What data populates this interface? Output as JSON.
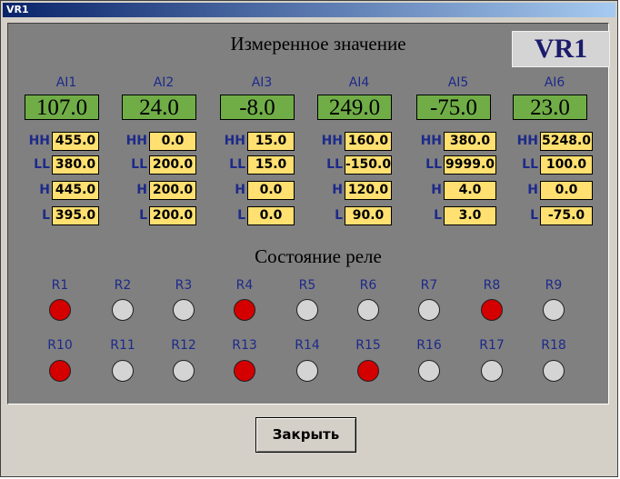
{
  "window": {
    "title": "VR1"
  },
  "header": {
    "title": "Измеренное значение",
    "device": "VR1"
  },
  "channels": [
    {
      "label": "AI1",
      "value": "107.0",
      "HH": "455.0",
      "LL": "380.0",
      "H": "445.0",
      "L": "395.0"
    },
    {
      "label": "AI2",
      "value": "24.0",
      "HH": "0.0",
      "LL": "200.0",
      "H": "200.0",
      "L": "200.0"
    },
    {
      "label": "AI3",
      "value": "-8.0",
      "HH": "15.0",
      "LL": "15.0",
      "H": "0.0",
      "L": "0.0"
    },
    {
      "label": "AI4",
      "value": "249.0",
      "HH": "160.0",
      "LL": "-150.0",
      "H": "120.0",
      "L": "90.0"
    },
    {
      "label": "AI5",
      "value": "-75.0",
      "HH": "380.0",
      "LL": "9999.0",
      "H": "4.0",
      "L": "3.0"
    },
    {
      "label": "AI6",
      "value": "23.0",
      "HH": "5248.0",
      "LL": "100.0",
      "H": "0.0",
      "L": "-75.0"
    }
  ],
  "limit_labels": [
    "HH",
    "LL",
    "H",
    "L"
  ],
  "relays": {
    "title": "Состояние реле",
    "on_color": "#d40000",
    "off_color": "#d4d4d4",
    "items": [
      {
        "label": "R1",
        "on": true
      },
      {
        "label": "R2",
        "on": false
      },
      {
        "label": "R3",
        "on": false
      },
      {
        "label": "R4",
        "on": true
      },
      {
        "label": "R5",
        "on": false
      },
      {
        "label": "R6",
        "on": false
      },
      {
        "label": "R7",
        "on": false
      },
      {
        "label": "R8",
        "on": true
      },
      {
        "label": "R9",
        "on": false
      },
      {
        "label": "R10",
        "on": true
      },
      {
        "label": "R11",
        "on": false
      },
      {
        "label": "R12",
        "on": false
      },
      {
        "label": "R13",
        "on": true
      },
      {
        "label": "R14",
        "on": false
      },
      {
        "label": "R15",
        "on": true
      },
      {
        "label": "R16",
        "on": false
      },
      {
        "label": "R17",
        "on": false
      },
      {
        "label": "R18",
        "on": false
      }
    ]
  },
  "buttons": {
    "close": "Закрыть"
  },
  "colors": {
    "panel": "#808080",
    "value_box": "#70ad47",
    "limit_box": "#ffe070",
    "label_text": "#1d2a8a"
  }
}
